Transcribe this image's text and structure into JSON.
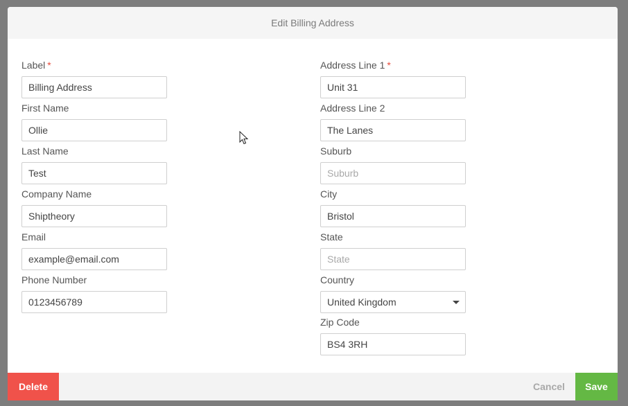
{
  "modal": {
    "title": "Edit Billing Address"
  },
  "left_fields": [
    {
      "label": "Label",
      "required": "*",
      "value": "Billing Address",
      "placeholder": ""
    },
    {
      "label": "First Name",
      "value": "Ollie",
      "placeholder": ""
    },
    {
      "label": "Last Name",
      "value": "Test",
      "placeholder": ""
    },
    {
      "label": "Company Name",
      "value": "Shiptheory",
      "placeholder": ""
    },
    {
      "label": "Email",
      "value": "example@email.com",
      "placeholder": ""
    },
    {
      "label": "Phone Number",
      "value": "0123456789",
      "placeholder": ""
    }
  ],
  "right_fields": [
    {
      "label": "Address Line 1",
      "required": "*",
      "value": "Unit 31",
      "placeholder": ""
    },
    {
      "label": "Address Line 2",
      "value": "The Lanes",
      "placeholder": ""
    },
    {
      "label": "Suburb",
      "value": "",
      "placeholder": "Suburb"
    },
    {
      "label": "City",
      "value": "Bristol",
      "placeholder": ""
    },
    {
      "label": "State",
      "value": "",
      "placeholder": "State"
    },
    {
      "label": "Country",
      "selected": "United Kingdom"
    },
    {
      "label": "Zip Code",
      "value": "BS4 3RH",
      "placeholder": ""
    }
  ],
  "footer": {
    "delete_label": "Delete",
    "cancel_label": "Cancel",
    "save_label": "Save"
  },
  "colors": {
    "delete": "#f0524a",
    "save": "#64b844",
    "required": "#e74c3c"
  }
}
